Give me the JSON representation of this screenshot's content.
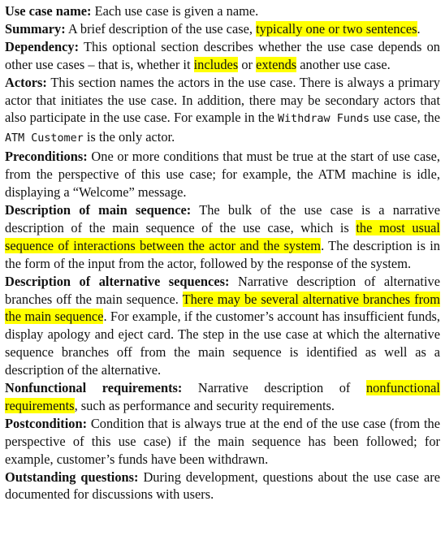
{
  "entries": [
    {
      "id": "use-case-name",
      "term": "Use case name:",
      "segments": [
        {
          "t": " Each use case is given a name."
        }
      ]
    },
    {
      "id": "summary",
      "term": "Summary:",
      "segments": [
        {
          "t": " A brief description of the use case, "
        },
        {
          "t": "typically one or two sen­tences",
          "hl": true
        },
        {
          "t": "."
        }
      ]
    },
    {
      "id": "dependency",
      "term": "Dependency:",
      "segments": [
        {
          "t": " This optional section describes whether the use case depends on other use cases – that is, whether it "
        },
        {
          "t": "includes",
          "hl": true
        },
        {
          "t": " or "
        },
        {
          "t": "extends",
          "hl": true
        },
        {
          "t": " another use case."
        }
      ]
    },
    {
      "id": "actors",
      "term": "Actors:",
      "segments": [
        {
          "t": " This section names the actors in the use case. There is always a pri­mary actor that initiates the use case. In addition, there may be secondary actors that also participate in the use case. For example in the "
        },
        {
          "t": "Withdraw Funds",
          "code": true
        },
        {
          "t": " use case, the "
        },
        {
          "t": "ATM Customer",
          "code": true
        },
        {
          "t": " is the only actor."
        }
      ]
    },
    {
      "id": "preconditions",
      "term": "Preconditions:",
      "segments": [
        {
          "t": " One or more conditions that must be true at the start of use case, from the perspective of this use case; for example, the ATM machine is idle, displaying a “Welcome” message."
        }
      ]
    },
    {
      "id": "main-sequence",
      "term": "Description of main sequence:",
      "segments": [
        {
          "t": " The bulk of the use case is a narrative description of the main sequence of the use case, which is "
        },
        {
          "t": "the most usual sequence of interactions between the actor and the system",
          "hl": true
        },
        {
          "t": ". The description is in the form of the input from the actor, followed by the response of the system."
        }
      ]
    },
    {
      "id": "alternative-sequences",
      "term": "Description of alternative sequences:",
      "segments": [
        {
          "t": " Narrative description of alternative branches off the main sequence. "
        },
        {
          "t": "There may be several alternative branches from the main sequence",
          "hl": true
        },
        {
          "t": ". For example, if the customer’s account has insuffi­cient funds, display apology and eject card. The step in the use case at which the alternative sequence branches off from the main sequence is identified as well as a description of the alternative."
        }
      ]
    },
    {
      "id": "nonfunctional",
      "term": "Nonfunctional requirements:",
      "segments": [
        {
          "t": " Narrative description of "
        },
        {
          "t": "nonfunctional requirements",
          "hl": true
        },
        {
          "t": ", such as performance and security requirements."
        }
      ]
    },
    {
      "id": "postcondition",
      "term": "Postcondition:",
      "segments": [
        {
          "t": " Condition that is always true at the end of the use case (from the perspective of this use case) if the main sequence has been followed; for example, customer’s funds have been withdrawn."
        }
      ]
    },
    {
      "id": "outstanding-questions",
      "term": "Outstanding questions:",
      "segments": [
        {
          "t": " During development, questions about the use case are documented for discussions with users."
        }
      ]
    }
  ]
}
